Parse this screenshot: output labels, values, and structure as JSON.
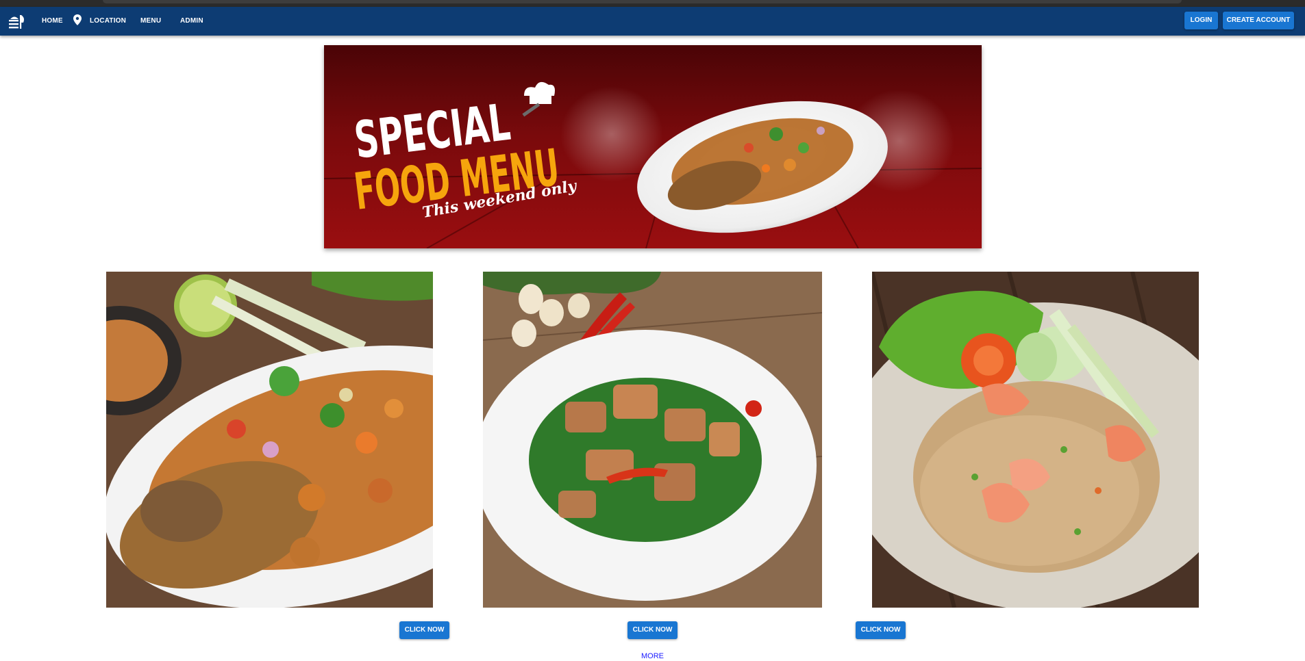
{
  "nav": {
    "logo_icon": "restaurant-logo-icon",
    "home": "HOME",
    "location_icon": "map-pin-icon",
    "location": "LOCATION",
    "menu": "MENU",
    "admin": "ADMIN",
    "login": "LOGIN",
    "create_account": "CREATE ACCOUNT",
    "bar_color": "#0d3c73",
    "button_color": "#1976d2"
  },
  "banner": {
    "line1": "SPECIAL",
    "line2": "FOOD MENU",
    "line3": "This weekend only"
  },
  "dishes": [
    {
      "image": "fried-fish-salad-photo",
      "button": "CLICK NOW"
    },
    {
      "image": "stir-fried-kale-pork-photo",
      "button": "CLICK NOW"
    },
    {
      "image": "shrimp-fried-rice-photo",
      "button": "CLICK NOW"
    }
  ],
  "more": "MORE"
}
